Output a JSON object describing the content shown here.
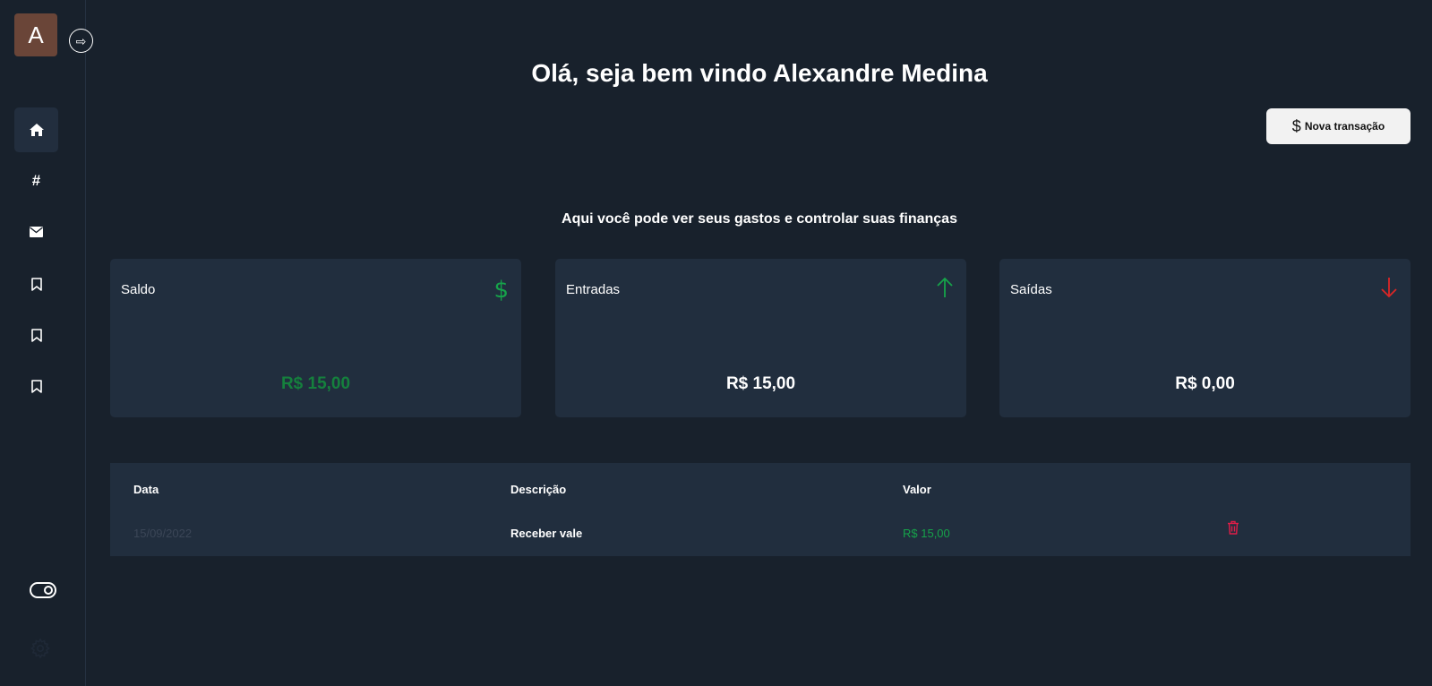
{
  "user": {
    "avatar_initial": "A"
  },
  "sidebar": {
    "expand_icon": "arrow-right-icon",
    "items": [
      {
        "icon": "home-icon",
        "active": true
      },
      {
        "icon": "hash-icon",
        "active": false
      },
      {
        "icon": "envelope-icon",
        "active": false
      },
      {
        "icon": "bookmark-icon",
        "active": false
      },
      {
        "icon": "bookmark-icon",
        "active": false
      },
      {
        "icon": "bookmark-icon",
        "active": false
      }
    ],
    "bottom": [
      {
        "icon": "toggle-icon"
      },
      {
        "icon": "gear-icon"
      }
    ]
  },
  "header": {
    "greeting": "Olá, seja bem vindo Alexandre Medina",
    "new_transaction_label": "Nova transação",
    "subtitle": "Aqui você pode ver seus gastos e controlar suas finanças"
  },
  "cards": [
    {
      "label": "Saldo",
      "amount": "R$ 15,00",
      "icon": "dollar-icon",
      "amount_color": "#15803d"
    },
    {
      "label": "Entradas",
      "amount": "R$ 15,00",
      "icon": "arrow-up-icon",
      "amount_color": "#ffffff"
    },
    {
      "label": "Saídas",
      "amount": "R$ 0,00",
      "icon": "arrow-down-icon",
      "amount_color": "#ffffff"
    }
  ],
  "table": {
    "headers": [
      "Data",
      "Descrição",
      "Valor"
    ],
    "rows": [
      {
        "date": "15/09/2022",
        "description": "Receber vale",
        "value": "R$ 15,00"
      }
    ]
  },
  "colors": {
    "background": "#18212c",
    "card": "#212e3e",
    "positive": "#16a34a",
    "negative": "#dc2626",
    "trash": "#e11d48"
  }
}
